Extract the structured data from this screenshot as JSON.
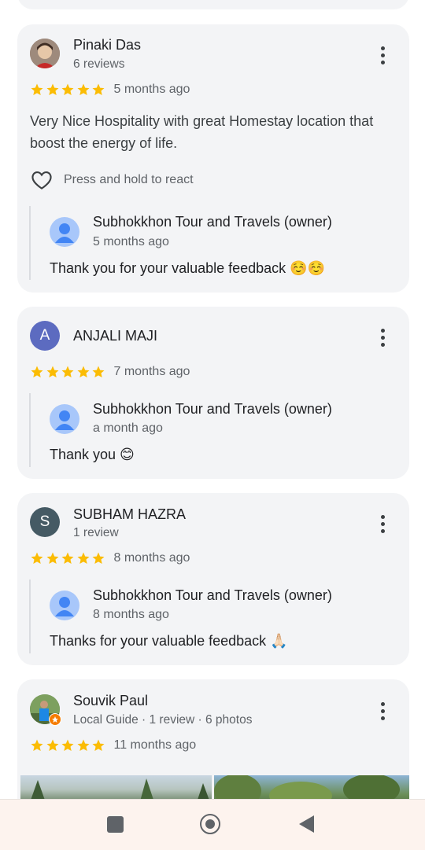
{
  "reviews": [
    {
      "name": "Pinaki Das",
      "meta": "6 reviews",
      "rating": 5,
      "time": "5 months ago",
      "text": "Very Nice Hospitality with great Homestay location that boost the energy of life.",
      "react_label": "Press and hold to react",
      "reply": {
        "owner": "Subhokkhon Tour and Travels (owner)",
        "time": "5 months ago",
        "text": "Thank you for your valuable feedback ☺️☺️"
      }
    },
    {
      "name": "ANJALI MAJI",
      "initial": "A",
      "avatar_color": "#5c6bc0",
      "rating": 5,
      "time": "7 months ago",
      "reply": {
        "owner": "Subhokkhon Tour and Travels (owner)",
        "time": "a month ago",
        "text": "Thank you 😊"
      }
    },
    {
      "name": "SUBHAM HAZRA",
      "initial": "S",
      "avatar_color": "#455a64",
      "meta": "1 review",
      "rating": 5,
      "time": "8 months ago",
      "reply": {
        "owner": "Subhokkhon Tour and Travels (owner)",
        "time": "8 months ago",
        "text": "Thanks for your valuable feedback 🙏🏻"
      }
    },
    {
      "name": "Souvik Paul",
      "meta": "Local Guide · 1 review · 6 photos",
      "rating": 5,
      "time": "11 months ago"
    }
  ],
  "colors": {
    "star": "#fbbc04",
    "card_bg": "#f3f4f6",
    "navbar_bg": "#fdf3ee",
    "owner_avatar": "#a8c7fa",
    "local_guide_badge": "#f57c00"
  },
  "navbar": {
    "icons": [
      "recents-square-icon",
      "home-circle-icon",
      "back-triangle-icon"
    ]
  }
}
